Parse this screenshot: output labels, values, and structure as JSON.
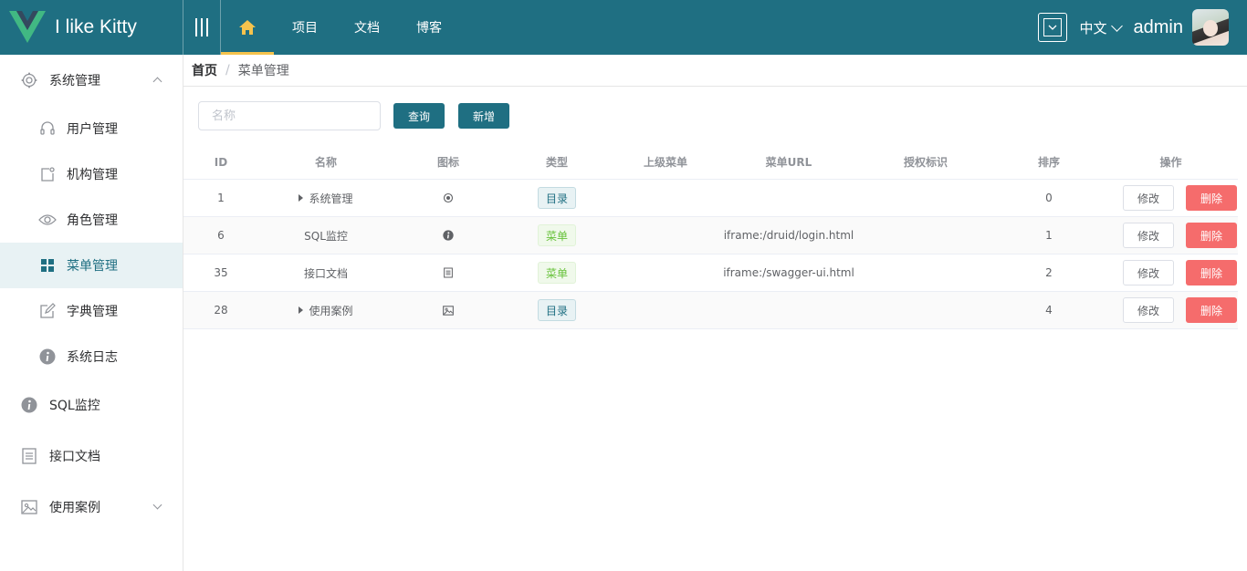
{
  "header": {
    "app_title": "I like Kitty",
    "nav": [
      {
        "label": "项目"
      },
      {
        "label": "文档"
      },
      {
        "label": "博客"
      }
    ],
    "language": "中文",
    "username": "admin",
    "colors": {
      "bar": "#1f6f82",
      "active_underline": "#f5c34d"
    }
  },
  "sidebar": {
    "groups": [
      {
        "label": "系统管理",
        "icon": "gear-icon",
        "expanded": true,
        "children": [
          {
            "label": "用户管理",
            "icon": "headset-icon"
          },
          {
            "label": "机构管理",
            "icon": "organization-icon"
          },
          {
            "label": "角色管理",
            "icon": "eye-icon"
          },
          {
            "label": "菜单管理",
            "icon": "grid-icon",
            "active": true
          },
          {
            "label": "字典管理",
            "icon": "edit-icon"
          },
          {
            "label": "系统日志",
            "icon": "info-icon"
          }
        ]
      },
      {
        "label": "SQL监控",
        "icon": "info-icon"
      },
      {
        "label": "接口文档",
        "icon": "document-icon"
      },
      {
        "label": "使用案例",
        "icon": "picture-icon",
        "expanded": false
      }
    ]
  },
  "breadcrumb": {
    "home": "首页",
    "separator": "/",
    "current": "菜单管理"
  },
  "toolbar": {
    "search_placeholder": "名称",
    "query_label": "查询",
    "add_label": "新增"
  },
  "table": {
    "columns": [
      "ID",
      "名称",
      "图标",
      "类型",
      "上级菜单",
      "菜单URL",
      "授权标识",
      "排序",
      "操作"
    ],
    "rows": [
      {
        "id": "1",
        "name": "系统管理",
        "expandable": true,
        "icon": "gear-icon",
        "type": "目录",
        "type_kind": "dir",
        "parent": "",
        "url": "",
        "perm": "",
        "order": "0"
      },
      {
        "id": "6",
        "name": "SQL监控",
        "expandable": false,
        "icon": "info-icon",
        "type": "菜单",
        "type_kind": "menu",
        "parent": "",
        "url": "iframe:/druid/login.html",
        "perm": "",
        "order": "1"
      },
      {
        "id": "35",
        "name": "接口文档",
        "expandable": false,
        "icon": "document-icon",
        "type": "菜单",
        "type_kind": "menu",
        "parent": "",
        "url": "iframe:/swagger-ui.html",
        "perm": "",
        "order": "2"
      },
      {
        "id": "28",
        "name": "使用案例",
        "expandable": true,
        "icon": "picture-icon",
        "type": "目录",
        "type_kind": "dir",
        "parent": "",
        "url": "",
        "perm": "",
        "order": "4"
      }
    ],
    "edit_label": "修改",
    "delete_label": "删除",
    "colors": {
      "delete": "#f56c6c",
      "menu_tag": "#67c23a",
      "dir_tag": "#1f6f82"
    }
  }
}
